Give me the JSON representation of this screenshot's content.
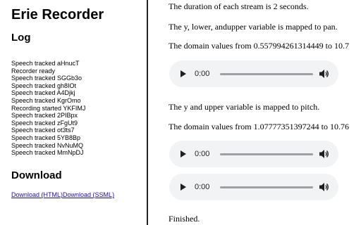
{
  "sidebar": {
    "title": "Erie Recorder",
    "log_heading": "Log",
    "log_entries": [
      "Speech tracked aHnucT",
      "Recorder ready",
      "Speech tracked SGGb3o",
      "Speech tracked gh8IOt",
      "Speech tracked A4Djkj",
      "Speech tracked KgrOmo",
      "Recording started YKFIMJ",
      "Speech tracked 2PIBpx",
      "Speech tracked zFgUt9",
      "Speech tracked ot3ts7",
      "Speech tracked 5YB8Bp",
      "Speech tracked NvNuMQ",
      "Speech tracked MmNpDJ"
    ],
    "download_heading": "Download",
    "download_html_label": "Download (HTML)",
    "download_ssml_label": "Download (SSML)"
  },
  "main": {
    "duration_text": "The duration of each stream is 2 seconds.",
    "mapping1_text": "The y, lower, andupper variable is mapped to pan.",
    "domain1_text": "The domain values from 0.557994261314449 to 10.7",
    "mapping2_text": "The y and upper variable is mapped to pitch.",
    "domain2_text": "The domain values from 1.07777351397244 to 10.76",
    "finished_text": "Finished.",
    "players": [
      {
        "time": "0:00"
      },
      {
        "time": "0:00"
      },
      {
        "time": "0:00"
      }
    ]
  },
  "colors": {
    "player_background": "#f1f3f4",
    "link": "#1a0dab"
  }
}
